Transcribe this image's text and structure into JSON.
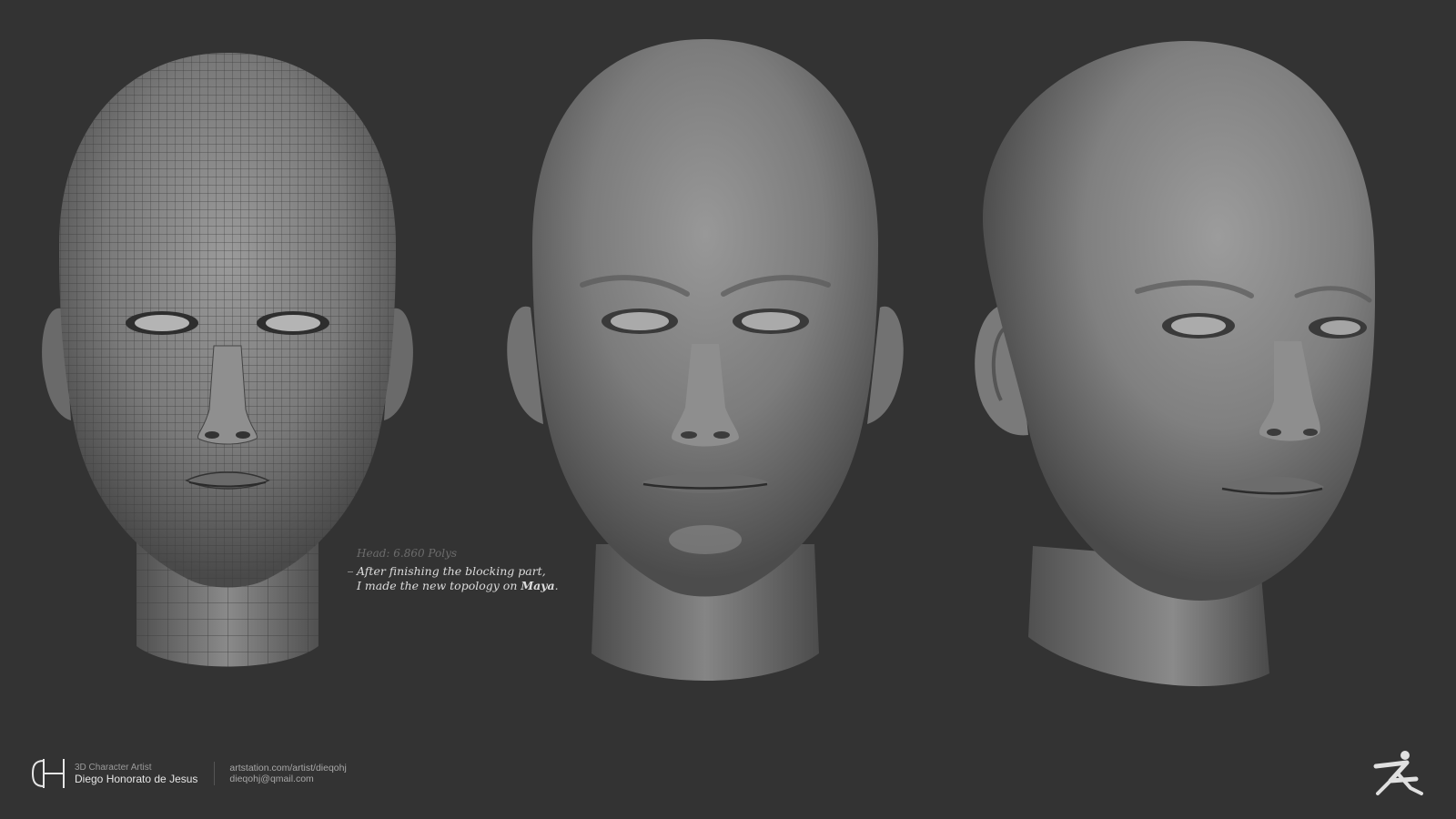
{
  "annotation": {
    "polys_label": "Head: 6.860 Polys",
    "line1": "After finishing the blocking part,",
    "line2_prefix": "I made the new topology on ",
    "line2_emphasis": "Maya",
    "line2_suffix": "."
  },
  "footer": {
    "logo_letters": "DH",
    "role": "3D Character Artist",
    "name": "Diego Honorato de Jesus",
    "website": "artstation.com/artist/dieqohj",
    "email": "dieqohj@qmail.com"
  },
  "icons": {
    "brand_logo": "dh-monogram-icon",
    "software_logo": "zbrush-icon"
  },
  "colors": {
    "background": "#333333",
    "clay": "#8c8c8c",
    "text_light": "#dcdcdc",
    "text_dim": "#6c6c6c"
  }
}
